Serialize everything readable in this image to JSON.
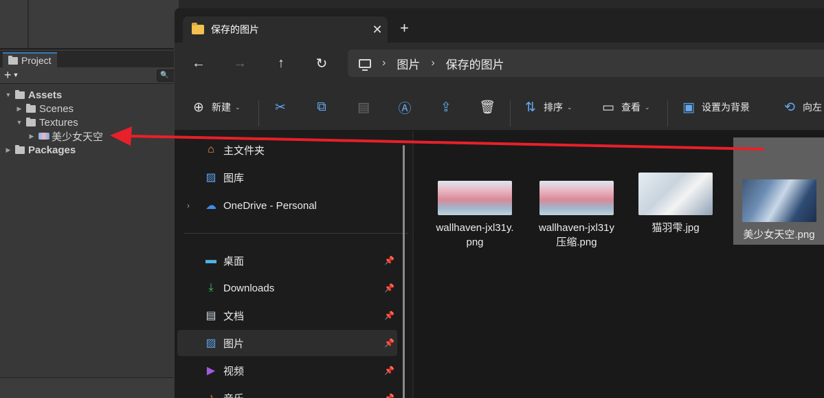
{
  "unity": {
    "project_tab": "Project",
    "add_button": "+",
    "tree": [
      {
        "label": "Assets"
      },
      {
        "label": "Scenes"
      },
      {
        "label": "Textures"
      },
      {
        "label": "美少女天空"
      },
      {
        "label": "Packages"
      }
    ]
  },
  "explorer": {
    "tab_title": "保存的图片",
    "tab_close": "✕",
    "new_tab": "+",
    "breadcrumb": [
      "图片",
      "保存的图片"
    ],
    "toolbar": {
      "new": "新建",
      "sort": "排序",
      "view": "查看",
      "set_background": "设置为背景",
      "rotate_left": "向左"
    },
    "nav": {
      "home": "主文件夹",
      "gallery": "图库",
      "onedrive": "OneDrive - Personal",
      "desktop": "桌面",
      "downloads": "Downloads",
      "documents": "文档",
      "pictures": "图片",
      "videos": "视频",
      "music": "音乐"
    },
    "files": [
      {
        "name": "wallhaven-jxl31y.png"
      },
      {
        "name": "wallhaven-jxl31y压缩.png"
      },
      {
        "name": "猫羽雫.jpg"
      },
      {
        "name": "美少女天空.png"
      }
    ]
  },
  "colors": {
    "accent_folder": "#f2c14e",
    "drag_arrow": "#e8202a",
    "unity_tab_highlight": "#3a79bb"
  }
}
